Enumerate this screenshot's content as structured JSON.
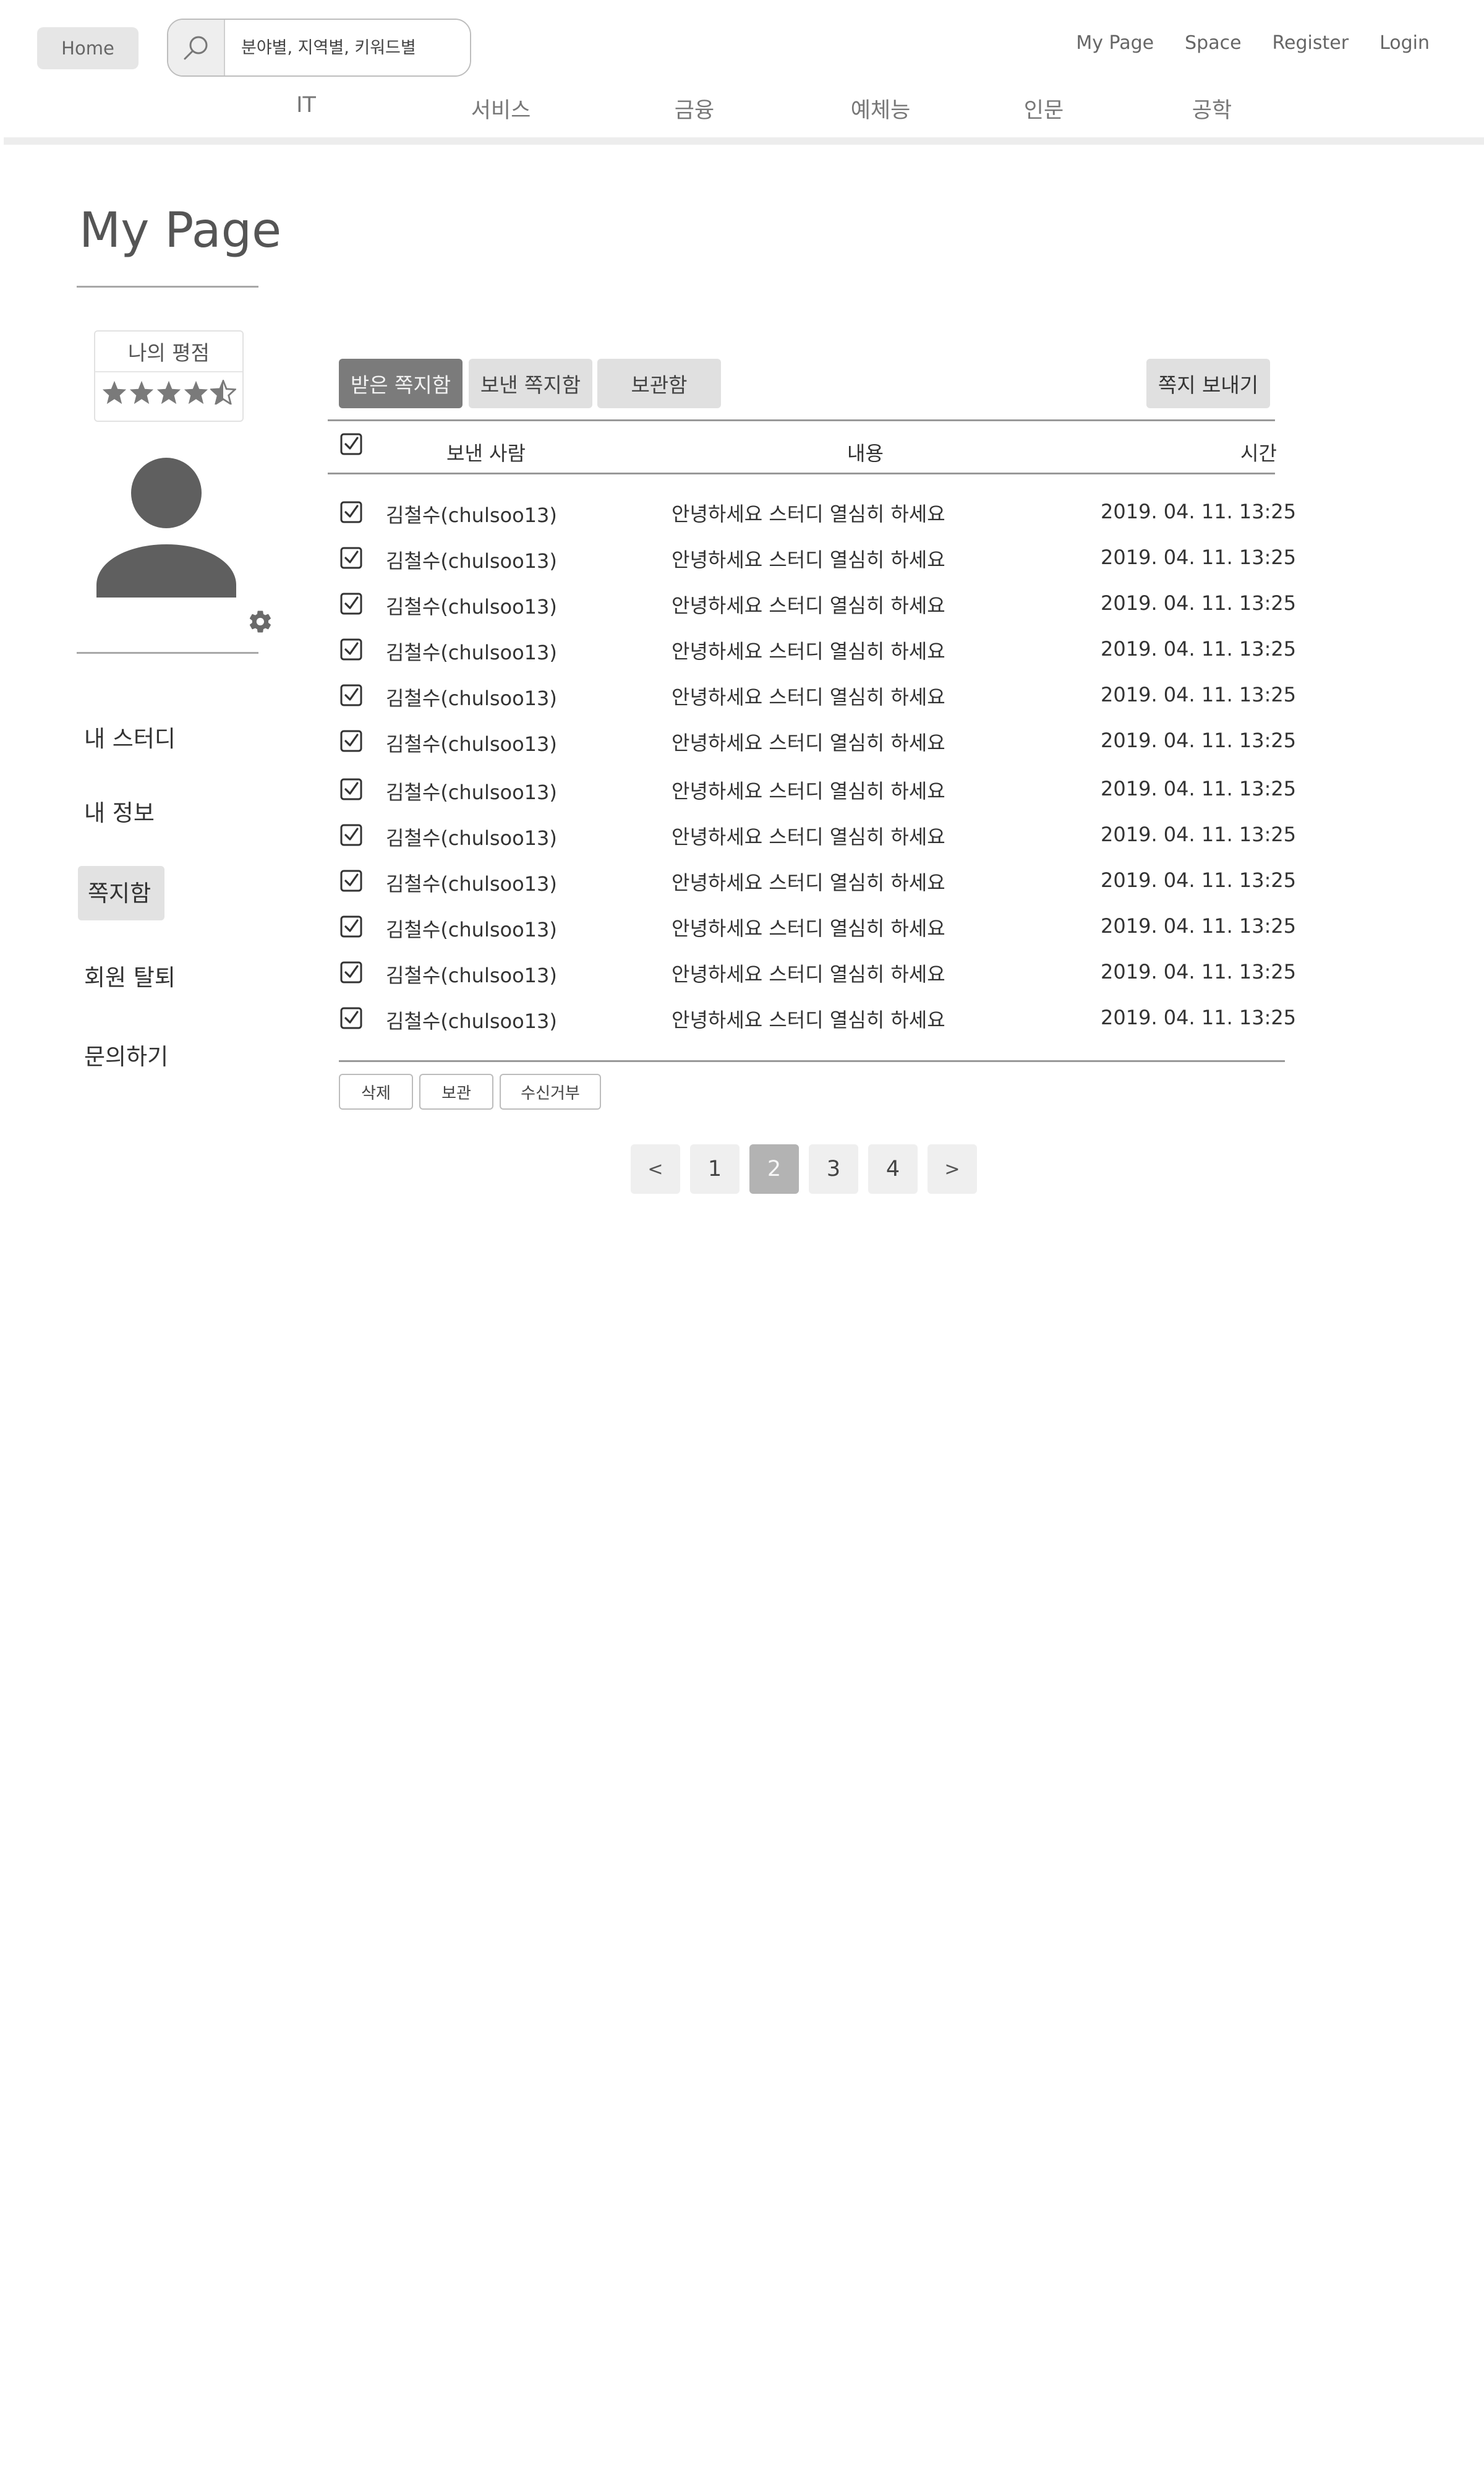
{
  "header": {
    "home_label": "Home",
    "search_placeholder": "분야별, 지역별, 키워드별",
    "search_icon": "search-icon",
    "links": [
      "My Page",
      "Space",
      "Register",
      "Login"
    ]
  },
  "nav": {
    "categories": [
      "IT",
      "서비스",
      "금융",
      "예체능",
      "인문",
      "공학"
    ]
  },
  "sidebar": {
    "title": "My Page",
    "rating_label": "나의 평점",
    "rating": 4.5,
    "rating_max": 5,
    "avatar_icon": "user-avatar-icon",
    "settings_icon": "gear-icon",
    "menu": [
      "내 스터디",
      "내 정보",
      "쪽지함",
      "회원 탈퇴",
      "문의하기"
    ],
    "active_menu": "쪽지함"
  },
  "tabs": {
    "received": "받은 쪽지함",
    "sent": "보낸 쪽지함",
    "storage": "보관함",
    "active": "받은 쪽지함",
    "send_button": "쪽지 보내기"
  },
  "table": {
    "headers": [
      "보낸 사람",
      "내용",
      "시간"
    ],
    "select_all_checked": true,
    "rows": [
      {
        "sender": "김철수(chulsoo13)",
        "content": "안녕하세요 스터디 열심히 하세요",
        "time": "2019. 04. 11. 13:25",
        "checked": true
      },
      {
        "sender": "김철수(chulsoo13)",
        "content": "안녕하세요 스터디 열심히 하세요",
        "time": "2019. 04. 11. 13:25",
        "checked": true
      },
      {
        "sender": "김철수(chulsoo13)",
        "content": "안녕하세요 스터디 열심히 하세요",
        "time": "2019. 04. 11. 13:25",
        "checked": true
      },
      {
        "sender": "김철수(chulsoo13)",
        "content": "안녕하세요 스터디 열심히 하세요",
        "time": "2019. 04. 11. 13:25",
        "checked": true
      },
      {
        "sender": "김철수(chulsoo13)",
        "content": "안녕하세요 스터디 열심히 하세요",
        "time": "2019. 04. 11. 13:25",
        "checked": true
      },
      {
        "sender": "김철수(chulsoo13)",
        "content": "안녕하세요 스터디 열심히 하세요",
        "time": "2019. 04. 11. 13:25",
        "checked": true
      },
      {
        "sender": "김철수(chulsoo13)",
        "content": "안녕하세요 스터디 열심히 하세요",
        "time": "2019. 04. 11. 13:25",
        "checked": true
      },
      {
        "sender": "김철수(chulsoo13)",
        "content": "안녕하세요 스터디 열심히 하세요",
        "time": "2019. 04. 11. 13:25",
        "checked": true
      },
      {
        "sender": "김철수(chulsoo13)",
        "content": "안녕하세요 스터디 열심히 하세요",
        "time": "2019. 04. 11. 13:25",
        "checked": true
      },
      {
        "sender": "김철수(chulsoo13)",
        "content": "안녕하세요 스터디 열심히 하세요",
        "time": "2019. 04. 11. 13:25",
        "checked": true
      },
      {
        "sender": "김철수(chulsoo13)",
        "content": "안녕하세요 스터디 열심히 하세요",
        "time": "2019. 04. 11. 13:25",
        "checked": true
      },
      {
        "sender": "김철수(chulsoo13)",
        "content": "안녕하세요 스터디 열심히 하세요",
        "time": "2019. 04. 11. 13:25",
        "checked": true
      }
    ]
  },
  "actions": {
    "delete": "삭제",
    "store": "보관",
    "block": "수신거부"
  },
  "pagination": {
    "prev": "<",
    "pages": [
      "1",
      "2",
      "3",
      "4"
    ],
    "current": "2",
    "next": ">"
  }
}
